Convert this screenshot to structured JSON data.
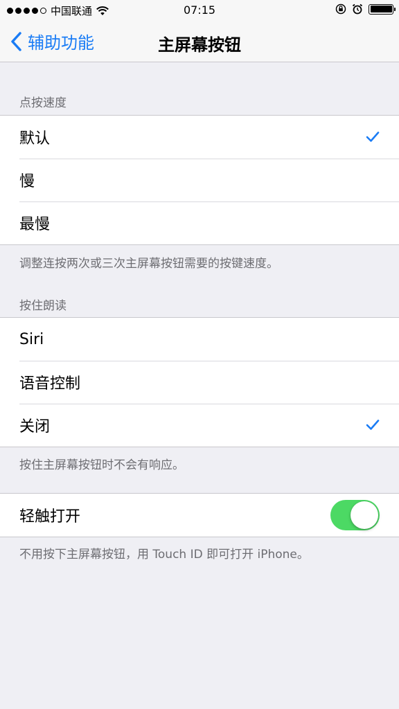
{
  "status_bar": {
    "carrier": "中国联通",
    "time": "07:15",
    "battery_level": 1.0
  },
  "nav": {
    "back_label": "辅助功能",
    "title": "主屏幕按钮"
  },
  "click_speed": {
    "header": "点按速度",
    "options": [
      {
        "label": "默认",
        "selected": true
      },
      {
        "label": "慢",
        "selected": false
      },
      {
        "label": "最慢",
        "selected": false
      }
    ],
    "footer": "调整连按两次或三次主屏幕按钮需要的按键速度。"
  },
  "press_and_hold": {
    "header": "按住朗读",
    "options": [
      {
        "label": "Siri",
        "selected": false
      },
      {
        "label": "语音控制",
        "selected": false
      },
      {
        "label": "关闭",
        "selected": true
      }
    ],
    "footer": "按住主屏幕按钮时不会有响应。"
  },
  "rest_finger": {
    "label": "轻触打开",
    "enabled": true,
    "footer": "不用按下主屏幕按钮，用 Touch ID 即可打开 iPhone。"
  },
  "colors": {
    "accent": "#1a7cf5",
    "toggle_on": "#4cd964",
    "background": "#efeff4"
  }
}
